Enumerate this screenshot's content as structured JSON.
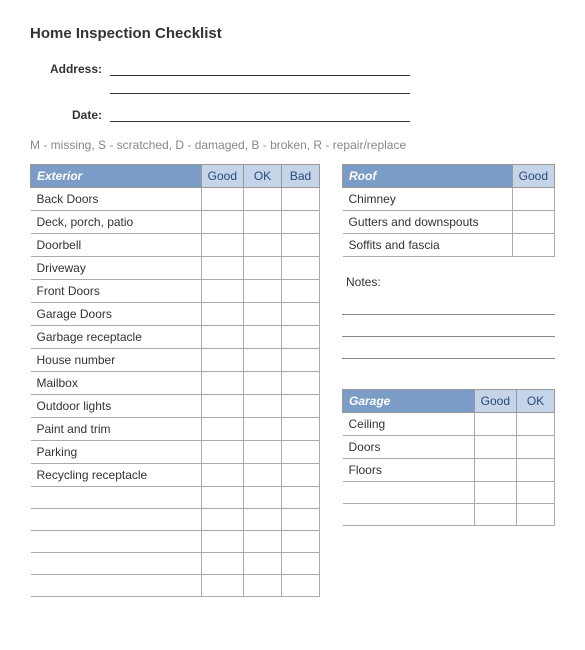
{
  "title": "Home Inspection Checklist",
  "fields": {
    "address_label": "Address:",
    "date_label": "Date:"
  },
  "legend": "M - missing,  S - scratched,  D - damaged,  B - broken,  R - repair/replace",
  "ratings": {
    "good": "Good",
    "ok": "OK",
    "bad": "Bad"
  },
  "sections": {
    "exterior": {
      "title": "Exterior",
      "items": [
        "Back Doors",
        "Deck, porch, patio",
        "Doorbell",
        "Driveway",
        "Front Doors",
        "Garage Doors",
        "Garbage receptacle",
        "House number",
        "Mailbox",
        "Outdoor lights",
        "Paint and trim",
        "Parking",
        "Recycling receptacle"
      ],
      "blank_rows": 5
    },
    "roof": {
      "title": "Roof",
      "items": [
        "Chimney",
        "Gutters and downspouts",
        "Soffits and fascia"
      ]
    },
    "garage": {
      "title": "Garage",
      "items": [
        "Ceiling",
        "Doors",
        "Floors"
      ],
      "blank_rows": 2
    }
  },
  "notes_label": "Notes:"
}
